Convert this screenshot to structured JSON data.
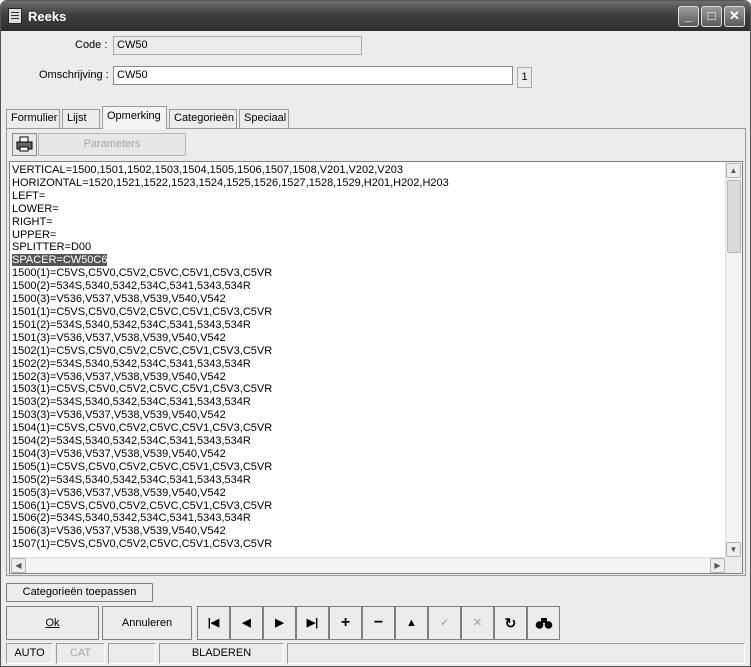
{
  "window": {
    "title": "Reeks"
  },
  "form": {
    "code_label": "Code :",
    "code_value": "CW50",
    "omschrijving_label": "Omschrijving :",
    "omschrijving_value": "CW50",
    "counter": "1"
  },
  "tabs": [
    "Formulier",
    "Lijst",
    "Opmerking",
    "Categorieën",
    "Speciaal"
  ],
  "active_tab": "Opmerking",
  "toolbar": {
    "parameters_label": "Parameters"
  },
  "editor": {
    "highlighted_line": 7,
    "lines": [
      "VERTICAL=1500,1501,1502,1503,1504,1505,1506,1507,1508,V201,V202,V203",
      "HORIZONTAL=1520,1521,1522,1523,1524,1525,1526,1527,1528,1529,H201,H202,H203",
      "LEFT=",
      "LOWER=",
      "RIGHT=",
      "UPPER=",
      "SPLITTER=D00",
      "SPACER=CW50C6",
      "1500(1)=C5VS,C5V0,C5V2,C5VC,C5V1,C5V3,C5VR",
      "1500(2)=534S,5340,5342,534C,5341,5343,534R",
      "1500(3)=V536,V537,V538,V539,V540,V542",
      "1501(1)=C5VS,C5V0,C5V2,C5VC,C5V1,C5V3,C5VR",
      "1501(2)=534S,5340,5342,534C,5341,5343,534R",
      "1501(3)=V536,V537,V538,V539,V540,V542",
      "1502(1)=C5VS,C5V0,C5V2,C5VC,C5V1,C5V3,C5VR",
      "1502(2)=534S,5340,5342,534C,5341,5343,534R",
      "1502(3)=V536,V537,V538,V539,V540,V542",
      "1503(1)=C5VS,C5V0,C5V2,C5VC,C5V1,C5V3,C5VR",
      "1503(2)=534S,5340,5342,534C,5341,5343,534R",
      "1503(3)=V536,V537,V538,V539,V540,V542",
      "1504(1)=C5VS,C5V0,C5V2,C5VC,C5V1,C5V3,C5VR",
      "1504(2)=534S,5340,5342,534C,5341,5343,534R",
      "1504(3)=V536,V537,V538,V539,V540,V542",
      "1505(1)=C5VS,C5V0,C5V2,C5VC,C5V1,C5V3,C5VR",
      "1505(2)=534S,5340,5342,534C,5341,5343,534R",
      "1505(3)=V536,V537,V538,V539,V540,V542",
      "1506(1)=C5VS,C5V0,C5V2,C5VC,C5V1,C5V3,C5VR",
      "1506(2)=534S,5340,5342,534C,5341,5343,534R",
      "1506(3)=V536,V537,V538,V539,V540,V542",
      "1507(1)=C5VS,C5V0,C5V2,C5VC,C5V1,C5V3,C5VR"
    ]
  },
  "buttons": {
    "categorieen_toepassen": "Categorieën toepassen",
    "ok": "Ok",
    "annuleren": "Annuleren"
  },
  "nav_icons": [
    "first-record-icon",
    "previous-record-icon",
    "next-record-icon",
    "last-record-icon",
    "add-record-icon",
    "delete-record-icon",
    "up-icon",
    "confirm-icon",
    "cancel-edit-icon",
    "refresh-icon",
    "find-icon"
  ],
  "statusbar": {
    "mode": "AUTO",
    "cat": "CAT",
    "state": "BLADEREN"
  }
}
